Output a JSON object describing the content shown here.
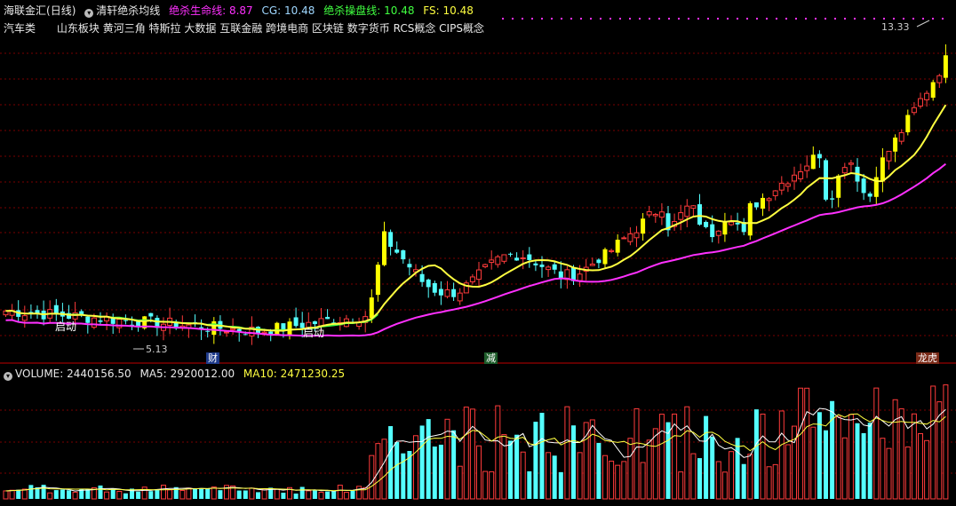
{
  "header": {
    "stock_name": "海联金汇",
    "period": "(日线)",
    "indicator_name": "清轩绝杀均线",
    "lifeline_label": "绝杀生命线:",
    "lifeline_value": "8.87",
    "cg_label": "CG:",
    "cg_value": "10.48",
    "control_label": "绝杀操盘线:",
    "control_value": "10.48",
    "fs_label": "FS:",
    "fs_value": "10.48"
  },
  "concepts": {
    "industry": "汽车类",
    "tags": [
      "山东板块",
      "黄河三角",
      "特斯拉",
      "大数据",
      "互联金融",
      "跨境电商",
      "区块链",
      "数字货币",
      "RCS概念",
      "CIPS概念"
    ]
  },
  "volume_header": {
    "volume_label": "VOLUME:",
    "volume_value": "2440156.50",
    "ma5_label": "MA5:",
    "ma5_value": "2920012.00",
    "ma10_label": "MA10:",
    "ma10_value": "2471230.25"
  },
  "annotations": {
    "high_price": "13.33",
    "low_price": "5.13",
    "start_label": "启动",
    "marker_cai": "财",
    "marker_jian": "减",
    "marker_longhu": "龙虎"
  },
  "colors": {
    "background": "#000000",
    "up_candle": "#ff3b3b",
    "down_candle": "#54ffff",
    "strong_candle": "#ffff00",
    "lifeline": "#ff30ff",
    "control_line": "#ffff40",
    "cg_line": "#40ff40",
    "grid": "#7a0000"
  }
}
